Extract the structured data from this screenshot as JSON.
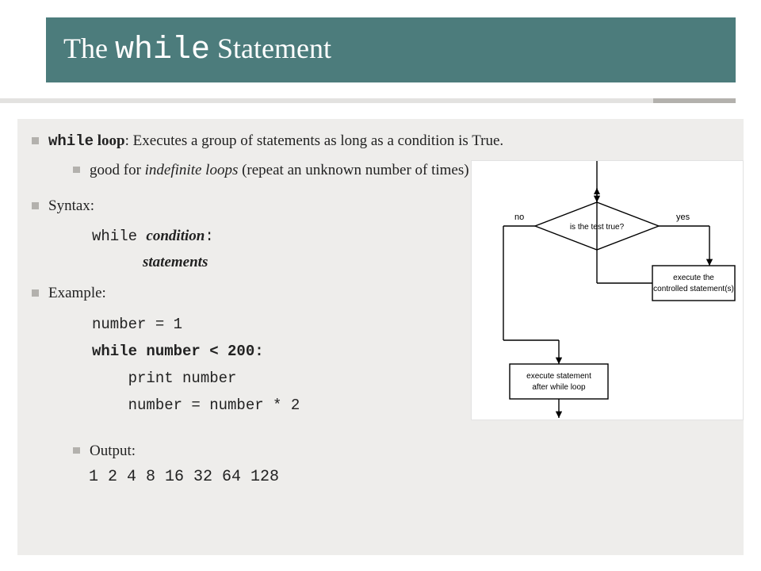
{
  "title": {
    "pre": "The ",
    "code": "while",
    "post": " Statement"
  },
  "bullets": {
    "loop_term": "while",
    "loop_label": " loop",
    "loop_desc": ": Executes a group of statements as long as a condition is True.",
    "sub_good_pre": "good for ",
    "sub_good_em": "indefinite loops",
    "sub_good_post": " (repeat an unknown number of times)",
    "syntax_label": "Syntax:",
    "syntax_line1_kw": "while ",
    "syntax_line1_cond": "condition",
    "syntax_line1_colon": ":",
    "syntax_line2": "statements",
    "example_label": "Example:",
    "ex_l1": "number = 1",
    "ex_l2": "while number < 200:",
    "ex_l3": "    print number",
    "ex_l4": "    number = number * 2",
    "output_label": "Output:",
    "output_values": "1 2 4 8 16 32 64 128"
  },
  "flowchart": {
    "decision": "is the test true?",
    "no": "no",
    "yes": "yes",
    "exec_body_l1": "execute the",
    "exec_body_l2": "controlled statement(s)",
    "after_l1": "execute statement",
    "after_l2": "after while loop"
  }
}
